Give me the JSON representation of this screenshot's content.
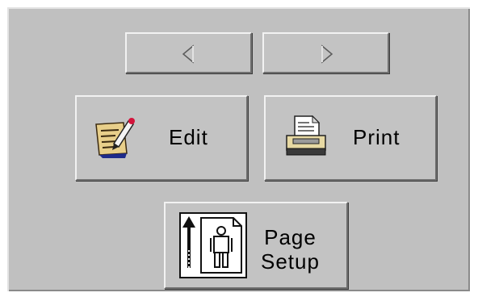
{
  "navigation": {
    "prev_icon": "left-triangle-arrow-icon",
    "next_icon": "right-triangle-arrow-icon"
  },
  "actions": {
    "edit": {
      "label": "Edit",
      "icon": "edit-document-pencil-icon"
    },
    "print": {
      "label": "Print",
      "icon": "printer-icon"
    },
    "page_setup": {
      "label_line1": "Page",
      "label_line2": "Setup",
      "icon": "page-setup-figure-icon"
    }
  },
  "colors": {
    "panel": "#c0c0c0",
    "button_face": "#c3c3c3",
    "highlight": "#f2f2f2",
    "shadow": "#6f6f6f"
  }
}
